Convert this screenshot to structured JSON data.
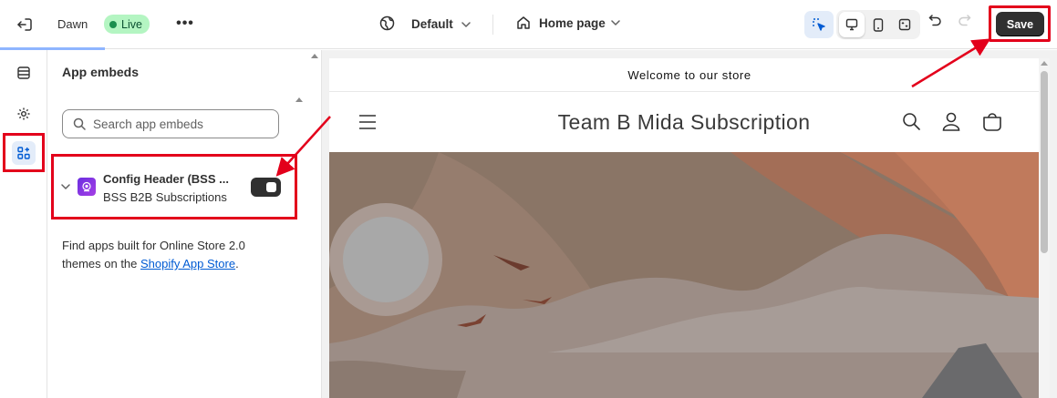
{
  "topbar": {
    "theme_name": "Dawn",
    "status_badge": "Live",
    "more_label": "•••",
    "locale_select": "Default",
    "page_select": "Home page",
    "save_label": "Save"
  },
  "sidebar": {
    "title": "App embeds",
    "search": {
      "placeholder": "Search app embeds",
      "value": ""
    },
    "embeds": [
      {
        "title": "Config Header (BSS ...",
        "app": "BSS B2B Subscriptions",
        "enabled": true
      }
    ],
    "help": {
      "text_before": "Find apps built for Online Store 2.0 themes on the ",
      "link": "Shopify App Store",
      "text_after": "."
    }
  },
  "preview": {
    "announcement": "Welcome to our store",
    "store_title": "Team B Mida Subscription"
  },
  "colors": {
    "highlight": "#e3001b",
    "save_bg": "#303030",
    "live_badge": "#b4f5c2",
    "link": "#005bd3"
  }
}
